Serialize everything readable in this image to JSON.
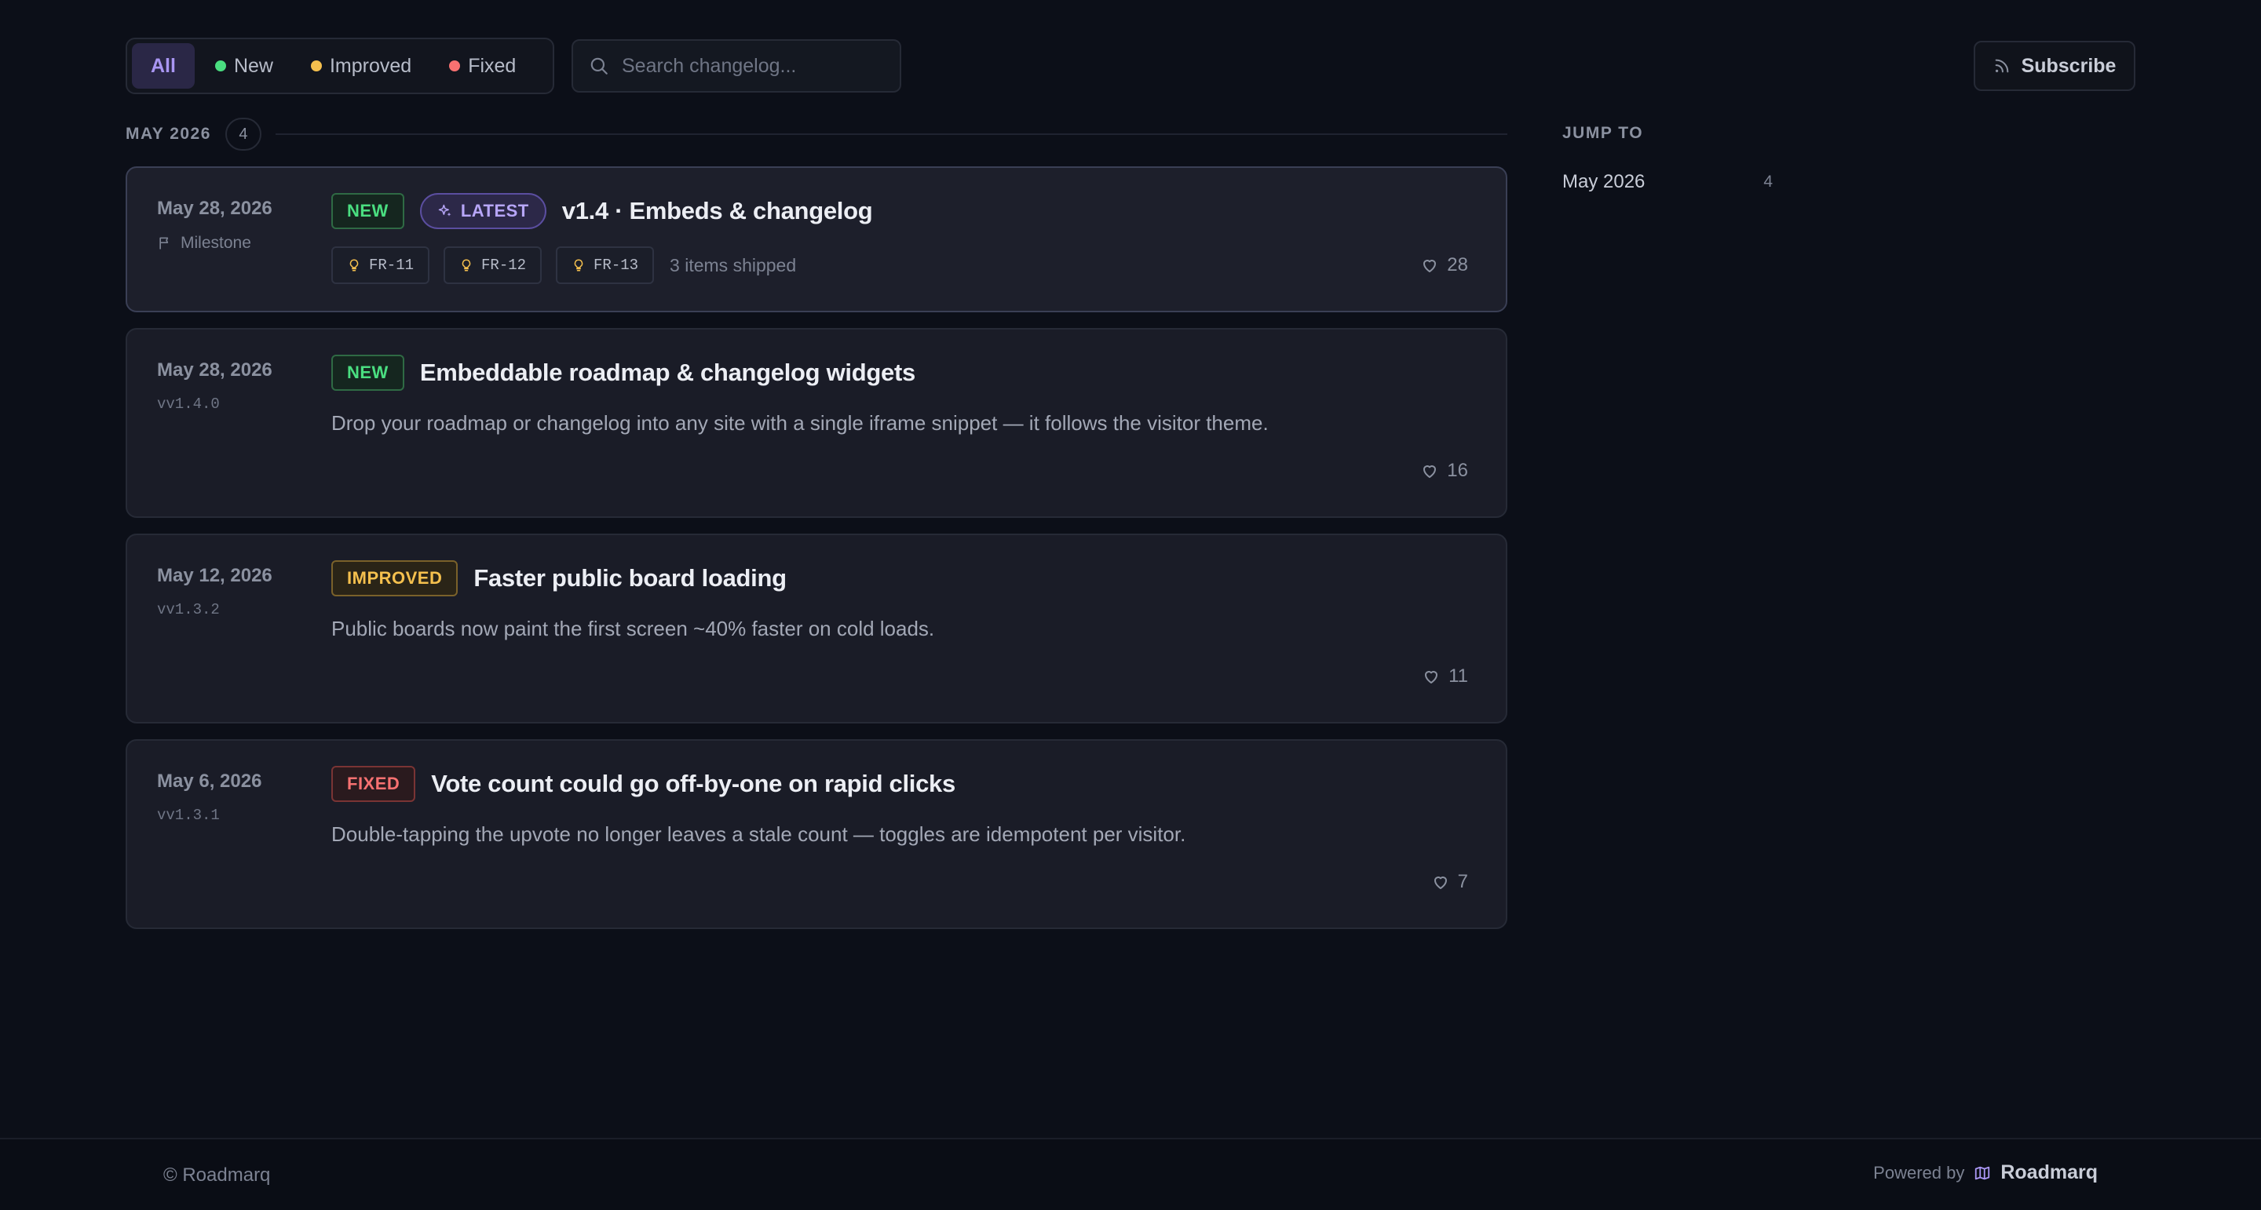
{
  "filters": {
    "items": [
      {
        "label": "All"
      },
      {
        "label": "New",
        "color": "#4ade80"
      },
      {
        "label": "Improved",
        "color": "#f5c04e"
      },
      {
        "label": "Fixed",
        "color": "#f87171"
      }
    ],
    "active": "All"
  },
  "search": {
    "placeholder": "Search changelog..."
  },
  "subscribe": {
    "label": "Subscribe",
    "icon": "rss-icon"
  },
  "month": {
    "label": "MAY 2026",
    "count": "4"
  },
  "entries": [
    {
      "date": "May 28, 2026",
      "sub": "Milestone",
      "badge": "NEW",
      "latest": "LATEST",
      "title": "v1.4 · Embeds & changelog",
      "chips": [
        "FR-11",
        "FR-12",
        "FR-13"
      ],
      "shipped": "3 items shipped",
      "likes": "28"
    },
    {
      "date": "May 28, 2026",
      "sub": "vv1.4.0",
      "badge": "NEW",
      "title": "Embeddable roadmap & changelog widgets",
      "desc": "Drop your roadmap or changelog into any site with a single iframe snippet — it follows the visitor theme.",
      "likes": "16"
    },
    {
      "date": "May 12, 2026",
      "sub": "vv1.3.2",
      "badge": "IMPROVED",
      "title": "Faster public board loading",
      "desc": "Public boards now paint the first screen ~40% faster on cold loads.",
      "likes": "11"
    },
    {
      "date": "May 6, 2026",
      "sub": "vv1.3.1",
      "badge": "FIXED",
      "title": "Vote count could go off-by-one on rapid clicks",
      "desc": "Double-tapping the upvote no longer leaves a stale count — toggles are idempotent per visitor.",
      "likes": "7"
    }
  ],
  "jump": {
    "title": "JUMP TO",
    "items": [
      {
        "label": "May 2026",
        "count": "4"
      }
    ]
  },
  "footer": {
    "copyright": "© Roadmarq",
    "powered_by": "Powered by",
    "brand": "Roadmarq"
  },
  "colors": {
    "accent": "#a996f3",
    "new": "#4ade80",
    "improved": "#f5c04e",
    "fixed": "#f87171"
  }
}
